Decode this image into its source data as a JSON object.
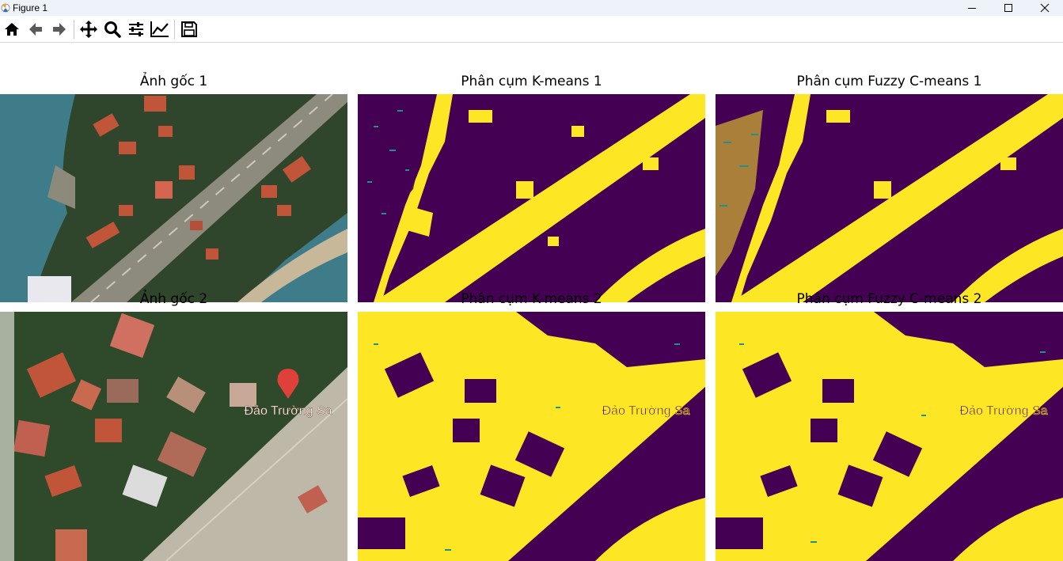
{
  "window": {
    "title": "Figure 1",
    "icon": "matplotlib-icon",
    "controls": [
      "minimize-icon",
      "maximize-icon",
      "close-icon"
    ]
  },
  "toolbar": {
    "buttons": [
      {
        "icon": "home-icon",
        "label": "Home"
      },
      {
        "icon": "back-arrow-icon",
        "label": "Back"
      },
      {
        "icon": "forward-arrow-icon",
        "label": "Forward"
      },
      {
        "icon": "pan-move-icon",
        "label": "Pan"
      },
      {
        "icon": "zoom-magnifier-icon",
        "label": "Zoom"
      },
      {
        "icon": "configure-subplots-icon",
        "label": "Subplots"
      },
      {
        "icon": "edit-axis-icon",
        "label": "Customize"
      },
      {
        "icon": "save-floppy-icon",
        "label": "Save"
      }
    ]
  },
  "figure": {
    "subplots": [
      {
        "title": "Ảnh gốc 1",
        "kind": "satellite-photo"
      },
      {
        "title": "Phân cụm K-means 1",
        "kind": "cluster-map"
      },
      {
        "title": "Phân cụm Fuzzy C-means 1",
        "kind": "cluster-map"
      },
      {
        "title": "Ảnh gốc 2",
        "kind": "satellite-photo"
      },
      {
        "title": "Phân cụm K-means 2",
        "kind": "cluster-map"
      },
      {
        "title": "Phân cụm Fuzzy C-means 2",
        "kind": "cluster-map"
      }
    ],
    "map_label": "Đảo Trường Sa",
    "colors": {
      "cluster_dark": "#440154",
      "cluster_light": "#fde725",
      "cluster_mid": "#21918c",
      "sea": "#3f7f8f",
      "vegetation": "#2f4a2a",
      "roof": "#c0553a",
      "runway": "#bdb8a8",
      "marker": "#e0403a"
    }
  }
}
